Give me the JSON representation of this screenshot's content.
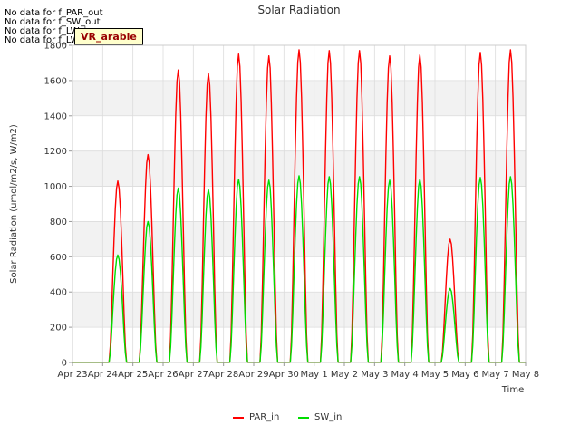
{
  "notes": [
    "No data for f_PAR_out",
    "No data for f_SW_out",
    "No data for f_LW_in",
    "No data for f_LW_out"
  ],
  "badge": "VR_arable",
  "colors": {
    "PAR_in": "#ff0000",
    "SW_in": "#00dd00",
    "band": "#f2f2f2",
    "grid": "#dcdcdc"
  },
  "chart_data": {
    "type": "line",
    "title": "Solar Radiation",
    "xlabel": "Time",
    "ylabel": "Solar Radiation (umol/m2/s, W/m2)",
    "ylim": [
      0,
      1800
    ],
    "yticks": [
      0,
      200,
      400,
      600,
      800,
      1000,
      1200,
      1400,
      1600,
      1800
    ],
    "xticks": [
      "Apr 23",
      "Apr 24",
      "Apr 25",
      "Apr 26",
      "Apr 27",
      "Apr 28",
      "Apr 29",
      "Apr 30",
      "May 1",
      "May 2",
      "May 3",
      "May 4",
      "May 5",
      "May 6",
      "May 7",
      "May 8"
    ],
    "xlim": [
      "Apr 23",
      "May 8"
    ],
    "grid": true,
    "legend": "bottom",
    "series": [
      {
        "name": "PAR_in",
        "daily": [
          {
            "date": "Apr 23",
            "peak": 0
          },
          {
            "date": "Apr 24",
            "peak": 1030
          },
          {
            "date": "Apr 25",
            "peak": 1180
          },
          {
            "date": "Apr 26",
            "peak": 1660
          },
          {
            "date": "Apr 27",
            "peak": 1640
          },
          {
            "date": "Apr 28",
            "peak": 1750
          },
          {
            "date": "Apr 29",
            "peak": 1740
          },
          {
            "date": "Apr 30",
            "peak": 1775
          },
          {
            "date": "May 1",
            "peak": 1770
          },
          {
            "date": "May 2",
            "peak": 1770
          },
          {
            "date": "May 3",
            "peak": 1740
          },
          {
            "date": "May 4",
            "peak": 1745
          },
          {
            "date": "May 5",
            "peak": 700
          },
          {
            "date": "May 6",
            "peak": 1760
          },
          {
            "date": "May 7",
            "peak": 1775
          }
        ]
      },
      {
        "name": "SW_in",
        "daily": [
          {
            "date": "Apr 23",
            "peak": 0
          },
          {
            "date": "Apr 24",
            "peak": 610
          },
          {
            "date": "Apr 25",
            "peak": 800
          },
          {
            "date": "Apr 26",
            "peak": 990
          },
          {
            "date": "Apr 27",
            "peak": 980
          },
          {
            "date": "Apr 28",
            "peak": 1040
          },
          {
            "date": "Apr 29",
            "peak": 1035
          },
          {
            "date": "Apr 30",
            "peak": 1060
          },
          {
            "date": "May 1",
            "peak": 1055
          },
          {
            "date": "May 2",
            "peak": 1055
          },
          {
            "date": "May 3",
            "peak": 1035
          },
          {
            "date": "May 4",
            "peak": 1040
          },
          {
            "date": "May 5",
            "peak": 420
          },
          {
            "date": "May 6",
            "peak": 1050
          },
          {
            "date": "May 7",
            "peak": 1055
          }
        ]
      }
    ]
  }
}
